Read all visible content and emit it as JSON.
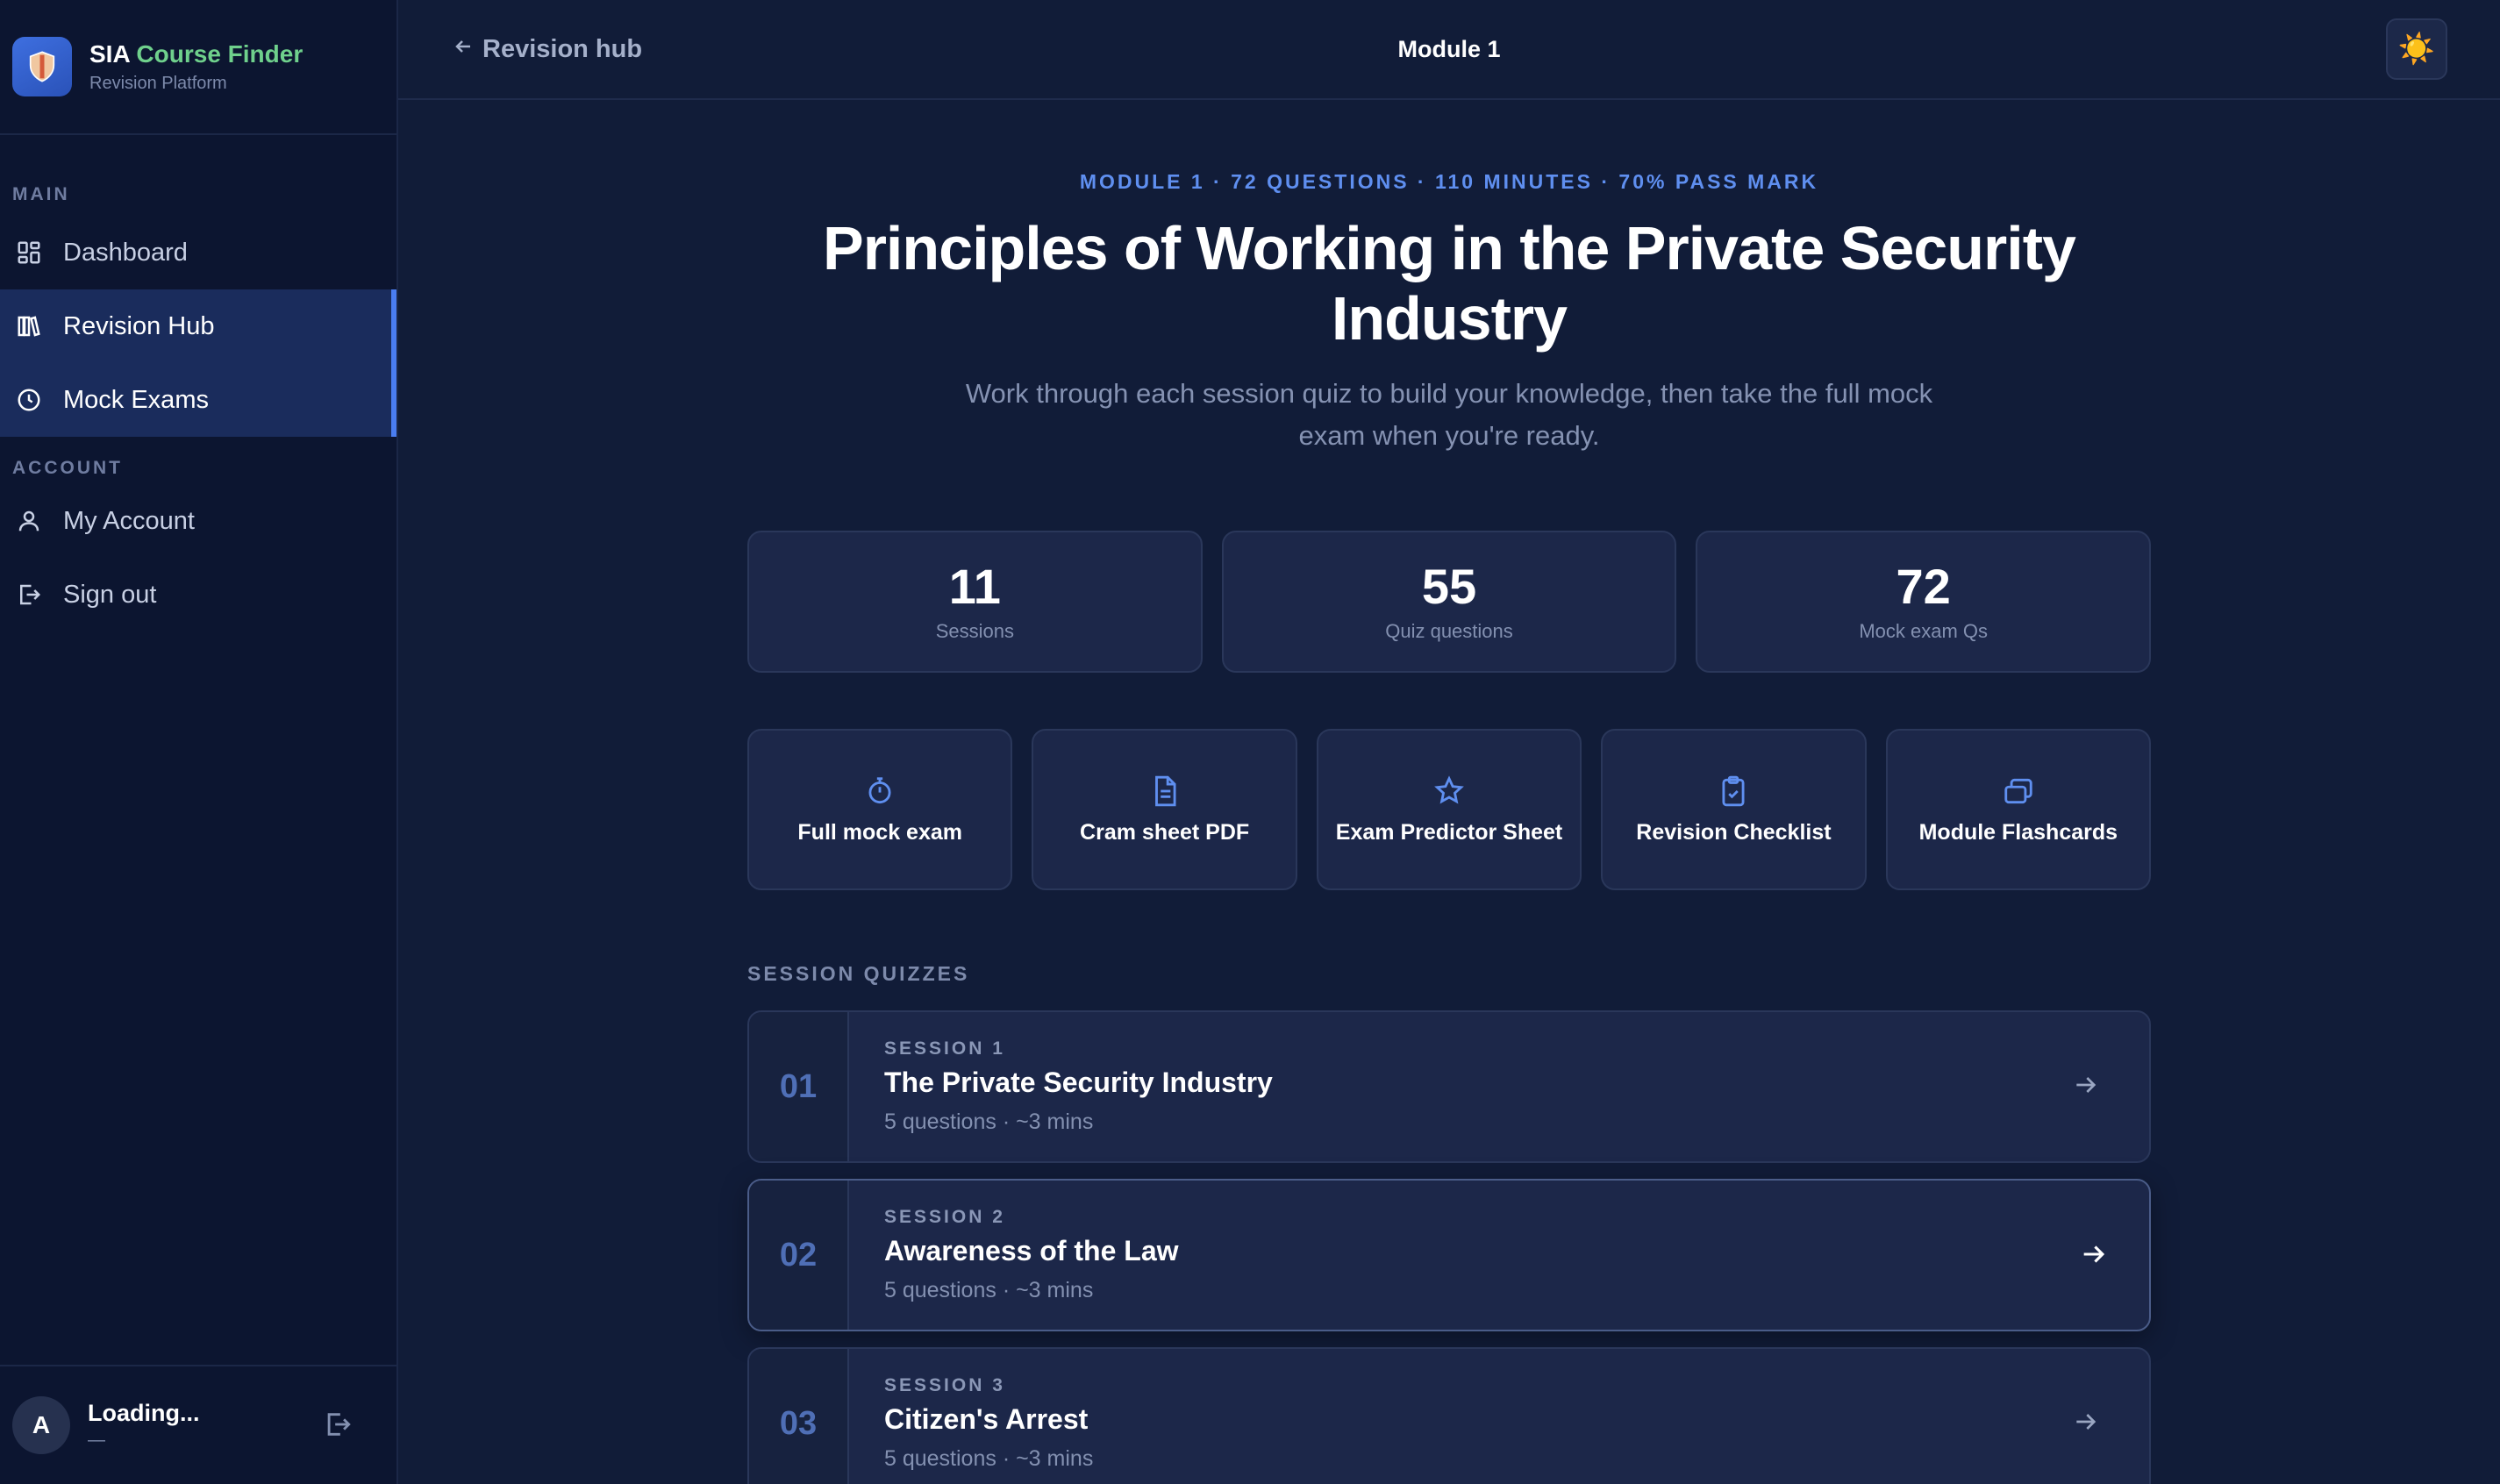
{
  "brand": {
    "name_part1": "SIA",
    "name_part2": "Course Finder",
    "subtitle": "Revision Platform"
  },
  "sidebar": {
    "sections": [
      {
        "label": "MAIN"
      },
      {
        "label": "ACCOUNT"
      }
    ],
    "main_items": [
      {
        "label": "Dashboard",
        "icon": "dashboard-icon"
      },
      {
        "label": "Revision Hub",
        "icon": "books-icon",
        "active": true
      },
      {
        "label": "Mock Exams",
        "icon": "clock-icon",
        "active": true
      }
    ],
    "account_items": [
      {
        "label": "My Account",
        "icon": "user-icon"
      },
      {
        "label": "Sign out",
        "icon": "signout-icon"
      }
    ],
    "user": {
      "initial": "A",
      "name": "Loading...",
      "sub": "—"
    }
  },
  "topbar": {
    "back_label": "Revision hub",
    "title": "Module 1",
    "theme_icon": "☀️"
  },
  "header": {
    "kicker": "MODULE 1 · 72 QUESTIONS · 110 MINUTES · 70% PASS MARK",
    "title_line1": "Principles of Working in the Private Security",
    "title_line2": "Industry",
    "lead": "Work through each session quiz to build your knowledge, then take the full mock exam when you're ready."
  },
  "stats": [
    {
      "value": "11",
      "label": "Sessions"
    },
    {
      "value": "55",
      "label": "Quiz questions"
    },
    {
      "value": "72",
      "label": "Mock exam Qs"
    }
  ],
  "actions": [
    {
      "label": "Full mock exam",
      "icon": "stopwatch-icon"
    },
    {
      "label": "Cram sheet PDF",
      "icon": "document-icon"
    },
    {
      "label": "Exam Predictor Sheet",
      "icon": "star-icon"
    },
    {
      "label": "Revision Checklist",
      "icon": "clipboard-check-icon"
    },
    {
      "label": "Module Flashcards",
      "icon": "cards-icon"
    }
  ],
  "sessions_title": "SESSION QUIZZES",
  "sessions": [
    {
      "num": "01",
      "kicker": "SESSION 1",
      "title": "The Private Security Industry",
      "meta": "5 questions · ~3 mins"
    },
    {
      "num": "02",
      "kicker": "SESSION 2",
      "title": "Awareness of the Law",
      "meta": "5 questions · ~3 mins"
    },
    {
      "num": "03",
      "kicker": "SESSION 3",
      "title": "Citizen's Arrest",
      "meta": "5 questions · ~3 mins"
    }
  ],
  "colors": {
    "accent": "#4a7df0",
    "brand_green": "#6fd08c",
    "background": "#111c38",
    "sidebar": "#0c1530",
    "card": "#1c2749"
  }
}
